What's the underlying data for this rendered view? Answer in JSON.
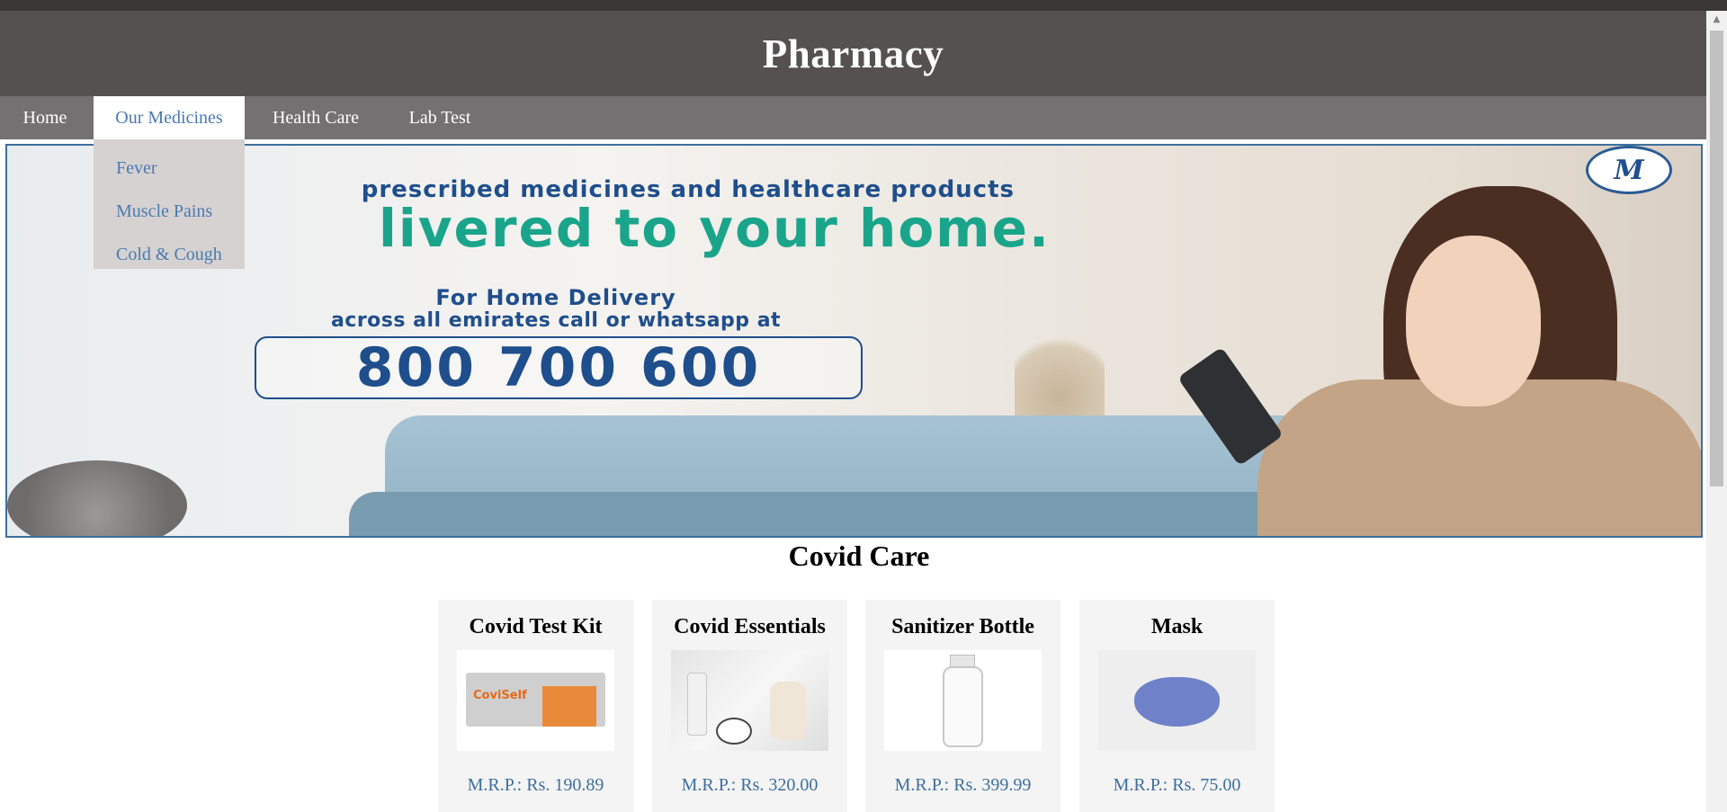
{
  "header": {
    "title": "Pharmacy"
  },
  "nav": {
    "items": [
      {
        "label": "Home"
      },
      {
        "label": "Our Medicines"
      },
      {
        "label": "Health Care"
      },
      {
        "label": "Lab Test"
      }
    ],
    "dropdown": [
      {
        "label": "Fever"
      },
      {
        "label": "Muscle Pains"
      },
      {
        "label": "Cold & Cough"
      }
    ]
  },
  "banner": {
    "line1": "prescribed medicines and healthcare products",
    "line2": "livered to your home.",
    "line3": "For Home Delivery",
    "line4": "across all emirates call or whatsapp at",
    "phone": "800 700 600"
  },
  "section": {
    "title": "Covid Care"
  },
  "products": [
    {
      "name": "Covid Test Kit",
      "price": "M.R.P.: Rs. 190.89",
      "image_label": "CoviSelf"
    },
    {
      "name": "Covid Essentials",
      "price": "M.R.P.: Rs. 320.00"
    },
    {
      "name": "Sanitizer Bottle",
      "price": "M.R.P.: Rs. 399.99"
    },
    {
      "name": "Mask",
      "price": "M.R.P.: Rs. 75.00"
    }
  ],
  "colors": {
    "header_bg": "#555150",
    "nav_bg": "#737171",
    "link_blue": "#4a7ab0",
    "banner_blue": "#1f4e8c",
    "banner_green": "#1aa58b"
  }
}
